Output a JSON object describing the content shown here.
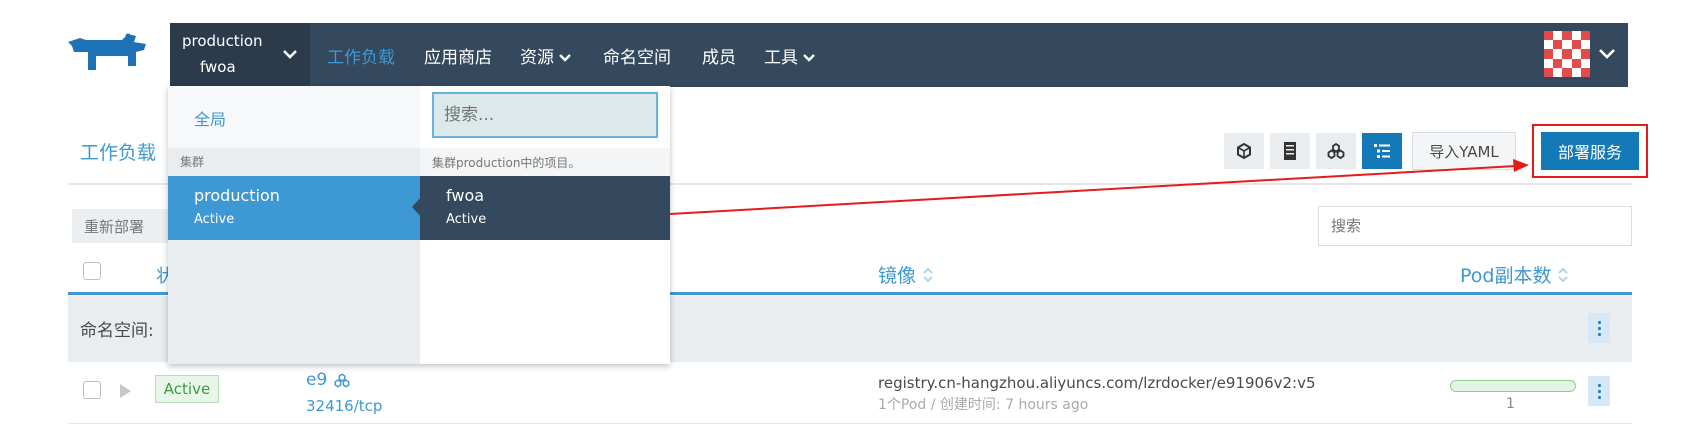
{
  "context": {
    "cluster": "production",
    "project": "fwoa"
  },
  "nav": {
    "items": [
      {
        "label": "工作负载",
        "active": true,
        "has_dropdown": false
      },
      {
        "label": "应用商店",
        "active": false,
        "has_dropdown": false
      },
      {
        "label": "资源",
        "active": false,
        "has_dropdown": true
      },
      {
        "label": "命名空间",
        "active": false,
        "has_dropdown": false
      },
      {
        "label": "成员",
        "active": false,
        "has_dropdown": false
      },
      {
        "label": "工具",
        "active": false,
        "has_dropdown": true
      }
    ]
  },
  "page": {
    "title": "工作负载"
  },
  "view_buttons": [
    {
      "icon": "cube-icon",
      "active": false
    },
    {
      "icon": "server-icon",
      "active": false
    },
    {
      "icon": "group-icon",
      "active": false
    },
    {
      "icon": "list-icon",
      "active": true
    }
  ],
  "actions": {
    "import_yaml": "导入YAML",
    "deploy": "部署服务"
  },
  "toolbar": {
    "redeploy": "重新部署",
    "search_placeholder": "搜索"
  },
  "table": {
    "headers": {
      "status": "状",
      "image": "镜像",
      "pods": "Pod副本数"
    },
    "group_label": "命名空间: ",
    "rows": [
      {
        "status": "Active",
        "name": "e9",
        "port": "32416/tcp",
        "image": "registry.cn-hangzhou.aliyuncs.com/lzrdocker/e91906v2:v5",
        "meta": "1个Pod / 创建时间: 7 hours ago",
        "pods": "1",
        "pod_ratio": 1.0
      }
    ]
  },
  "dropdown": {
    "global": "全局",
    "cluster_header": "集群",
    "search_placeholder": "搜索...",
    "project_header": "集群production中的项目。",
    "clusters": [
      {
        "name": "production",
        "state": "Active"
      }
    ],
    "projects": [
      {
        "name": "fwoa",
        "state": "Active"
      }
    ]
  },
  "colors": {
    "nav_bg": "#34495e",
    "accent": "#3d98d3",
    "primary_button": "#137ab7",
    "annotation_red": "#e31c1c",
    "active_green": "#3c9b44"
  }
}
